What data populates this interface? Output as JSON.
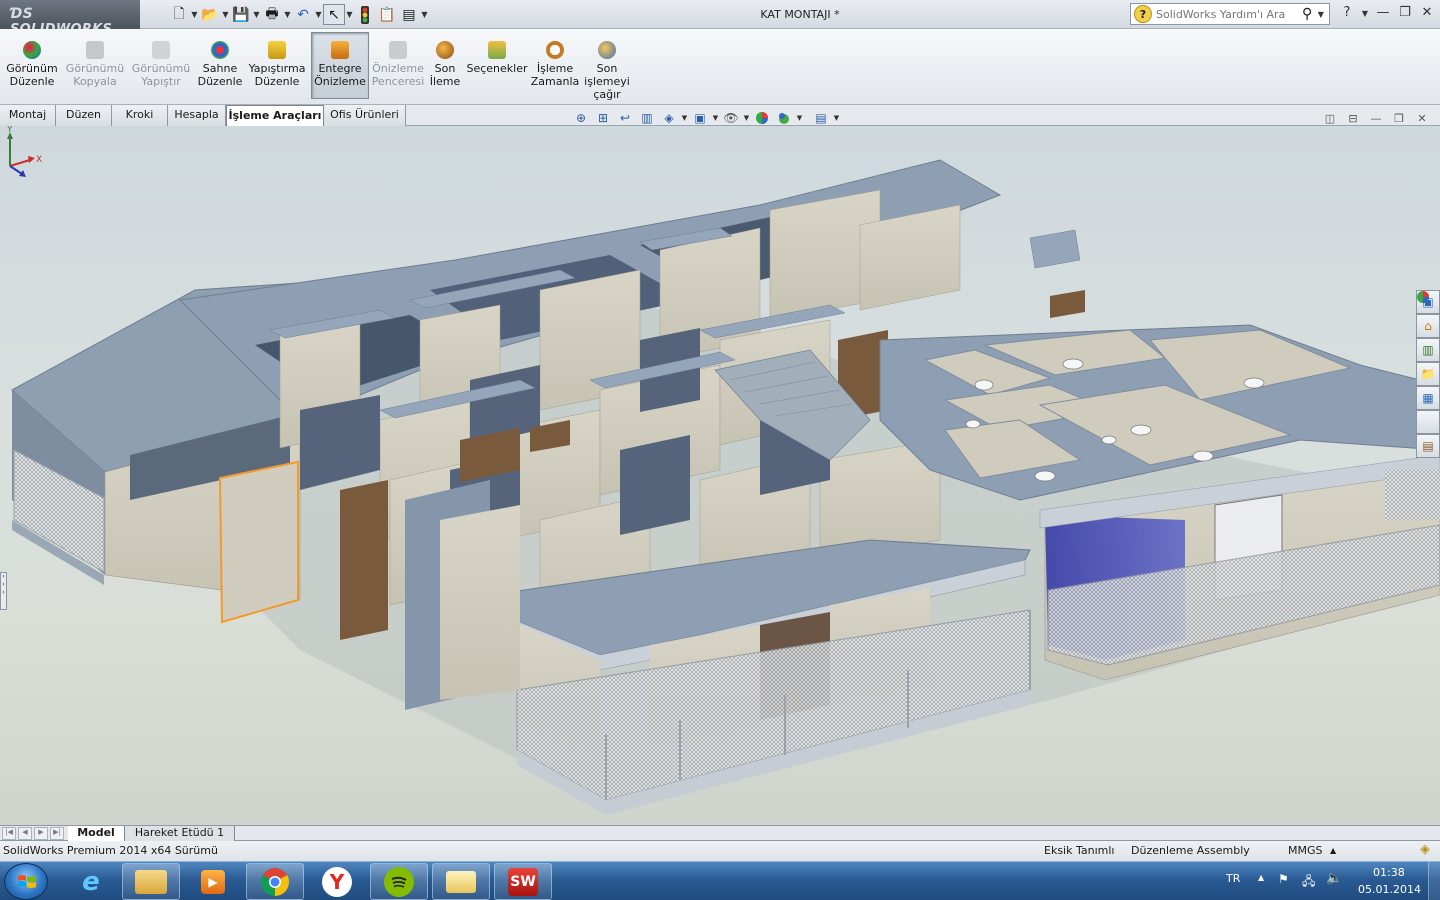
{
  "app": {
    "brand": "SOLIDWORKS",
    "document_title": "KAT MONTAJI *",
    "help_search_placeholder": "SolidWorks Yardım'ı Ara"
  },
  "quick_access": [
    "new-document-icon",
    "open-folder-icon",
    "save-icon",
    "print-icon",
    "undo-icon",
    "select-arrow-icon",
    "rebuild-traffic-light-icon",
    "file-properties-icon",
    "options-icon"
  ],
  "command_manager": [
    {
      "line1": "Görünüm",
      "line2": "Düzenle",
      "line3": "",
      "enabled": true
    },
    {
      "line1": "Görünümü",
      "line2": "Kopyala",
      "line3": "",
      "enabled": false
    },
    {
      "line1": "Görünümü",
      "line2": "Yapıştır",
      "line3": "",
      "enabled": false
    },
    {
      "line1": "Sahne",
      "line2": "Düzenle",
      "line3": "",
      "enabled": true
    },
    {
      "line1": "Yapıştırma",
      "line2": "Düzenle",
      "line3": "",
      "enabled": true
    },
    {
      "line1": "Entegre",
      "line2": "Önizleme",
      "line3": "",
      "enabled": true,
      "active": true
    },
    {
      "line1": "Önizleme",
      "line2": "Penceresi",
      "line3": "",
      "enabled": false
    },
    {
      "line1": "Son",
      "line2": "İleme",
      "line3": "",
      "enabled": true
    },
    {
      "line1": "Seçenekler",
      "line2": "",
      "line3": "",
      "enabled": true
    },
    {
      "line1": "İşleme",
      "line2": "Zamanla",
      "line3": "",
      "enabled": true
    },
    {
      "line1": "Son",
      "line2": "işlemeyi",
      "line3": "çağır",
      "enabled": true
    }
  ],
  "tabs": [
    {
      "label": "Montaj"
    },
    {
      "label": "Düzen"
    },
    {
      "label": "Kroki"
    },
    {
      "label": "Hesapla"
    },
    {
      "label": "İşleme Araçları",
      "active": true
    },
    {
      "label": "Ofis Ürünleri"
    }
  ],
  "heads_up_view_toolbar": [
    "zoom-to-fit-icon",
    "zoom-to-area-icon",
    "previous-view-icon",
    "section-view-icon",
    "view-orientation-icon",
    "display-style-icon",
    "hide-show-items-icon",
    "edit-appearance-icon",
    "apply-scene-icon",
    "view-settings-icon"
  ],
  "task_pane": [
    "solidworks-resources-icon",
    "home-icon",
    "design-library-icon",
    "file-explorer-icon",
    "view-palette-icon",
    "appearances-icon",
    "custom-properties-icon"
  ],
  "triad": {
    "y": "Y",
    "x": "X"
  },
  "model_tabs": [
    {
      "label": "Model",
      "active": true
    },
    {
      "label": "Hareket Etüdü 1",
      "active": false
    }
  ],
  "status_bar": {
    "version": "SolidWorks Premium 2014 x64 Sürümü",
    "definition": "Eksik Tanımlı",
    "mode": "Düzenleme Assembly",
    "units": "MMGS"
  },
  "taskbar": {
    "apps": [
      "internet-explorer-icon",
      "file-explorer-icon",
      "media-player-icon",
      "chrome-icon",
      "yandex-browser-icon",
      "spotify-icon",
      "folder-icon",
      "solidworks-icon"
    ],
    "language": "TR",
    "time": "01:38",
    "date": "05.01.2014"
  },
  "colors": {
    "viewport_bg": "#d6dddb",
    "wall_top": "#8e9fb3",
    "wall_side": "#d6d3c3",
    "wall_dark": "#56657a",
    "selection": "#f39a2c",
    "glass_blue": "#3a3fae",
    "taskbar": "#2a5b94"
  }
}
